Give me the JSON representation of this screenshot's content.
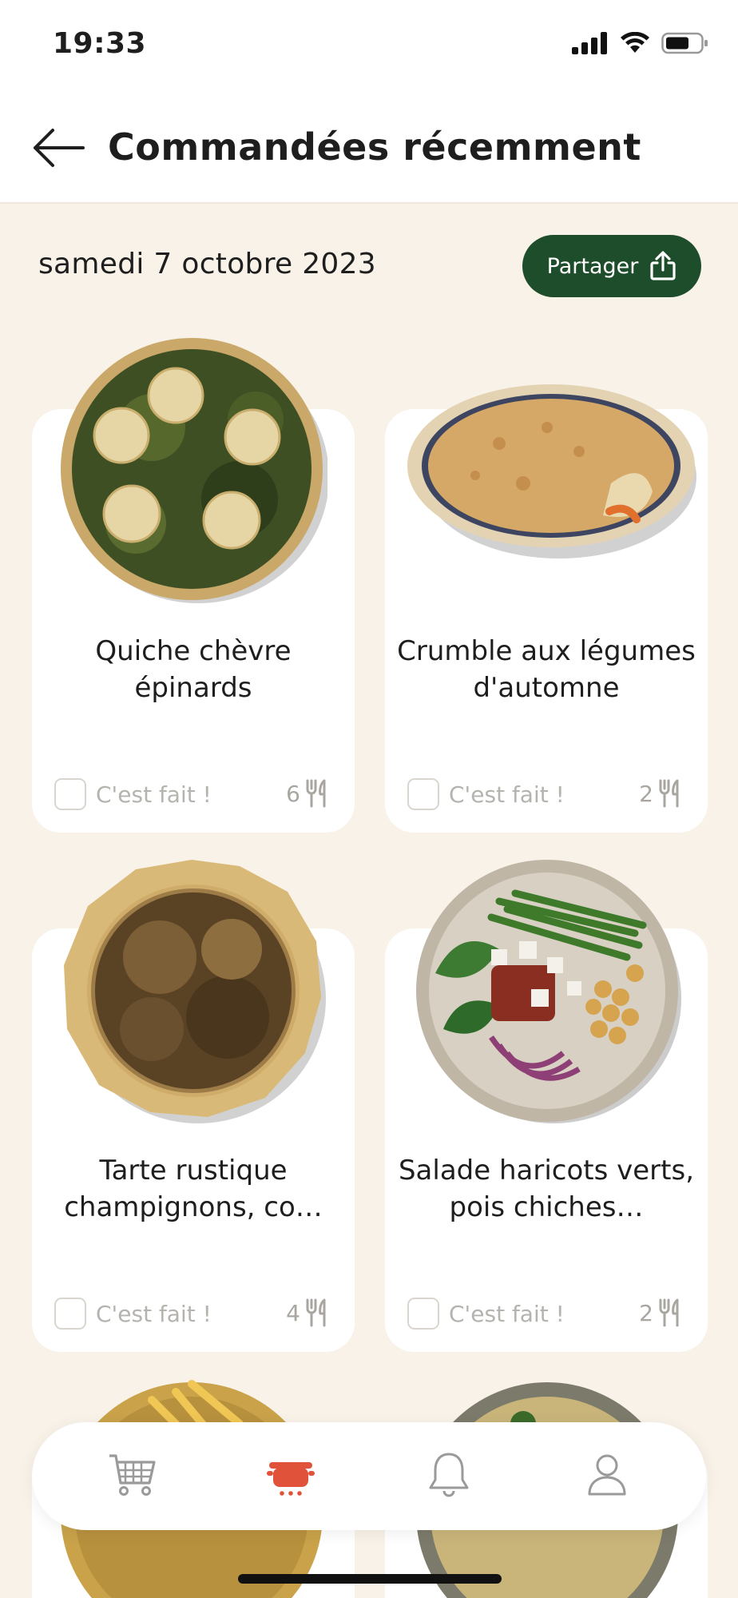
{
  "status_bar": {
    "time": "19:33"
  },
  "header": {
    "title": "Commandées récemment"
  },
  "date_section": {
    "date": "samedi 7 octobre 2023",
    "share_label": "Partager"
  },
  "recipes": [
    {
      "title": "Quiche chèvre épinards",
      "done_label": "C'est fait !",
      "servings": "6",
      "image": "quiche-image"
    },
    {
      "title": "Crumble aux légumes d'automne",
      "done_label": "C'est fait !",
      "servings": "2",
      "image": "crumble-image"
    },
    {
      "title": "Tarte rustique champignons, co…",
      "done_label": "C'est fait !",
      "servings": "4",
      "image": "tart-image"
    },
    {
      "title": "Salade haricots verts, pois chiches…",
      "done_label": "C'est fait !",
      "servings": "2",
      "image": "salad-image"
    }
  ],
  "bottom_nav": {
    "items": [
      {
        "icon": "cart-icon",
        "active": false
      },
      {
        "icon": "pot-icon",
        "active": true
      },
      {
        "icon": "bell-icon",
        "active": false
      },
      {
        "icon": "user-icon",
        "active": false
      }
    ]
  },
  "colors": {
    "background": "#F8F2E8",
    "accent_green": "#1E4D2B",
    "active_tab": "#E0533A",
    "inactive_icon": "#9A9A9A"
  }
}
